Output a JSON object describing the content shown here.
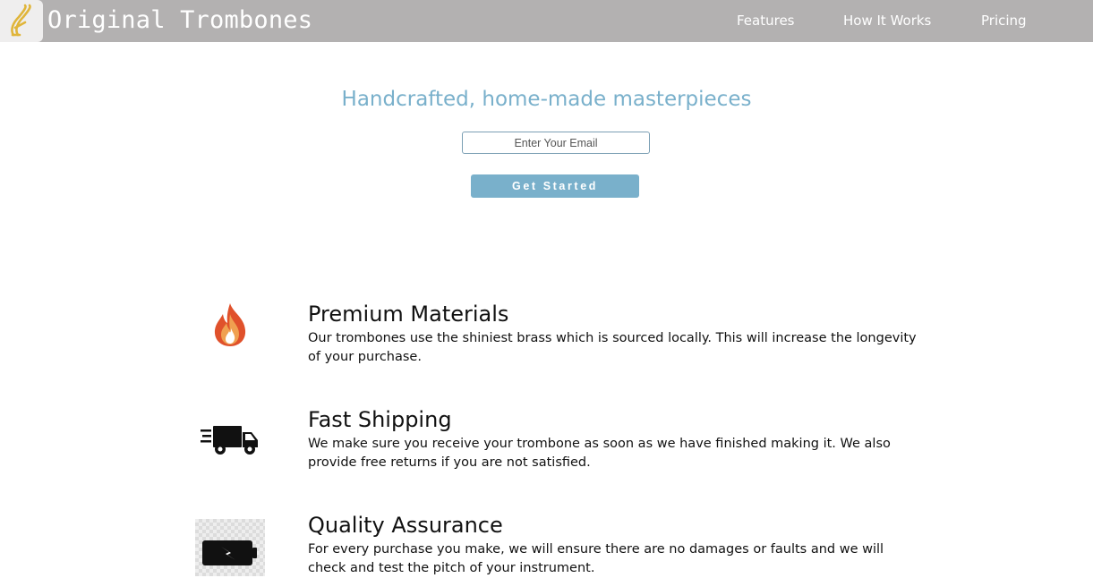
{
  "header": {
    "brand": "Original Trombones",
    "logo_icon": "trombone-logo-icon",
    "nav": [
      {
        "label": "Features"
      },
      {
        "label": "How It Works"
      },
      {
        "label": "Pricing"
      }
    ]
  },
  "hero": {
    "title": "Handcrafted, home-made masterpieces",
    "email_placeholder": "Enter Your Email",
    "email_value": "",
    "cta_label": "Get Started"
  },
  "features": [
    {
      "icon": "flame-icon",
      "title": "Premium Materials",
      "description": "Our trombones use the shiniest brass which is sourced locally. This will increase the longevity of your purchase."
    },
    {
      "icon": "truck-icon",
      "title": "Fast Shipping",
      "description": "We make sure you receive your trombone as soon as we have finished making it. We also provide free returns if you are not satisfied."
    },
    {
      "icon": "battery-icon",
      "title": "Quality Assurance",
      "description": "For every purchase you make, we will ensure there are no damages or faults and we will check and test the pitch of your instrument."
    }
  ],
  "colors": {
    "header_bg": "#b3b1b1",
    "accent": "#79b0cb",
    "text": "#111111"
  }
}
